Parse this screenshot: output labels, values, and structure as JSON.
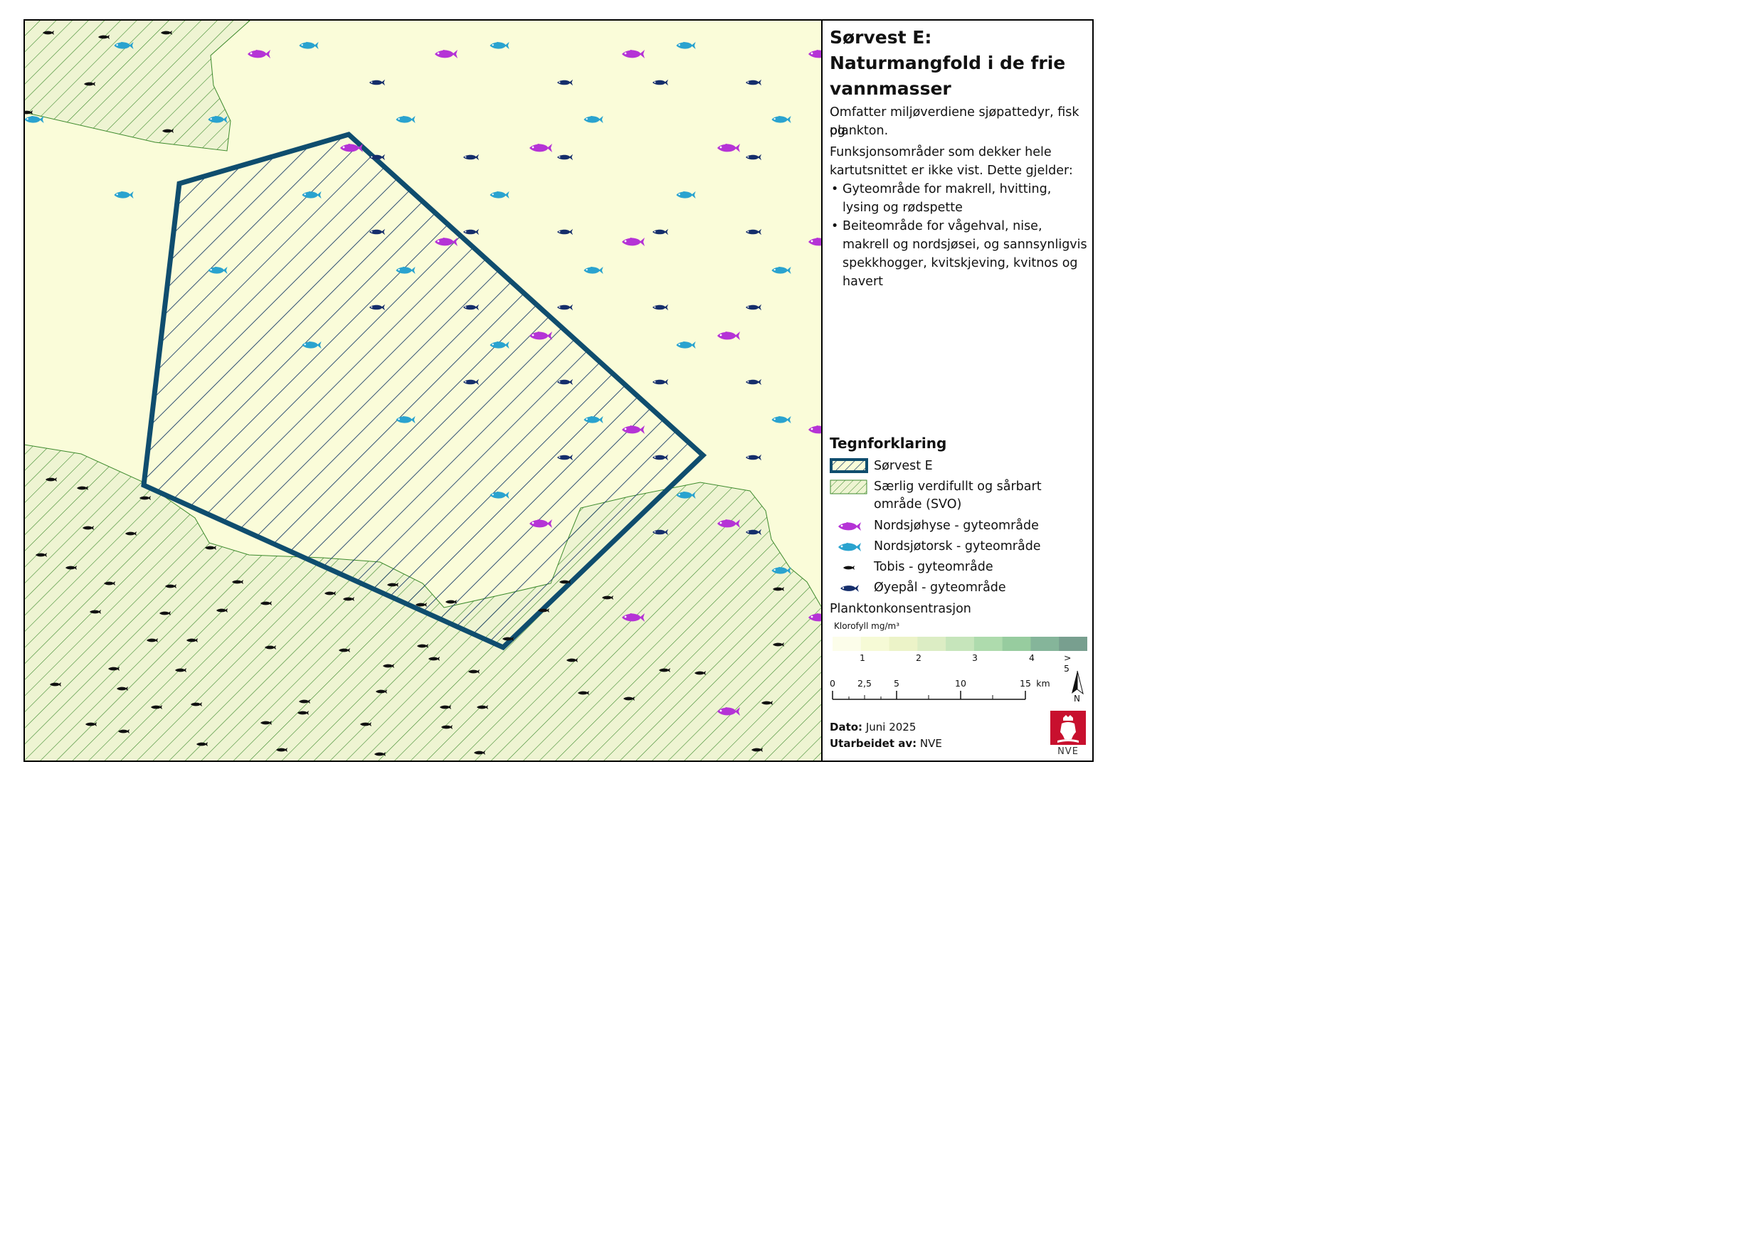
{
  "title": "Sørvest E:\nNaturmangfold i de frie vannmasser",
  "title_lines": [
    "Sørvest E:",
    "Naturmangfold i de frie",
    "vannmasser"
  ],
  "intro": "Omfatter miljøverdiene sjøpattedyr, fisk og plankton.",
  "intro_lines": [
    "Omfatter miljøverdiene sjøpattedyr, fisk og",
    "plankton."
  ],
  "note_lines": [
    "Funksjonsområder som dekker hele",
    "kartutsnittet er ikke vist. Dette gjelder:"
  ],
  "bullets": [
    [
      "Gyteområde for makrell, hvitting,",
      "lysing og rødspette"
    ],
    [
      "Beiteområde for vågehval, nise,",
      "makrell og nordsjøsei, og sannsynligvis",
      "spekkhogger, kvitskjeving, kvitnos og",
      "havert"
    ]
  ],
  "legend": {
    "title": "Tegnforklaring",
    "items": [
      {
        "label": "Sørvest E"
      },
      {
        "label": "Særlig verdifullt og sårbart område (SVO)"
      },
      {
        "label": "Nordsjøhyse - gyteområde",
        "color": "#b533d6"
      },
      {
        "label": "Nordsjøtorsk - gyteområde",
        "color": "#2aa3cf"
      },
      {
        "label": "Tobis - gyteområde",
        "color": "#111111"
      },
      {
        "label": "Øyepål - gyteområde",
        "color": "#152e6b"
      }
    ],
    "plankton_title": "Planktonkonsentrasjon",
    "plankton_unit": "Klorofyll mg/m³",
    "plankton_colors": [
      "#fcfdea",
      "#f6fad6",
      "#ecf3c8",
      "#dcedc4",
      "#c6e5bb",
      "#aedbad",
      "#97cc9f",
      "#85b59a",
      "#789f8f"
    ],
    "plankton_ticks": [
      "1",
      "2",
      "3",
      "4",
      "> 5"
    ]
  },
  "scalebar": {
    "ticks": [
      "0",
      "2,5",
      "5",
      "10",
      "15"
    ],
    "unit": "km"
  },
  "north": "N",
  "footer": {
    "date_label": "Dato:",
    "date_value": "Juni 2025",
    "author_label": "Utarbeidet av:",
    "author_value": "NVE"
  },
  "logo_text": "NVE",
  "colors": {
    "sea": "#fafcd9",
    "svo_fill": "#eef4d2",
    "svo_hatch": "#3d8a2c",
    "area_outline": "#0f4d6e",
    "area_hatch": "#1b3f68",
    "hyse": "#b533d6",
    "torsk": "#2aa3cf",
    "tobis": "#111111",
    "oyepal": "#152e6b",
    "logo_red": "#c8102e"
  }
}
